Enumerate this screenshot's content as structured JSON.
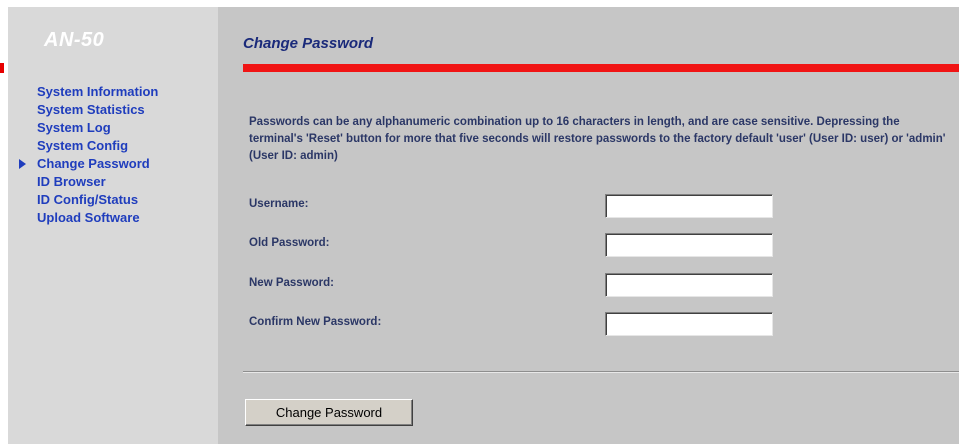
{
  "sidebar": {
    "logo": "AN-50",
    "items": [
      {
        "label": "System Information",
        "active": false
      },
      {
        "label": "System Statistics",
        "active": false
      },
      {
        "label": "System Log",
        "active": false
      },
      {
        "label": "System Config",
        "active": false
      },
      {
        "label": "Change Password",
        "active": true
      },
      {
        "label": "ID Browser",
        "active": false
      },
      {
        "label": "ID Config/Status",
        "active": false
      },
      {
        "label": "Upload Software",
        "active": false
      }
    ]
  },
  "main": {
    "title": "Change Password",
    "description": "Passwords can be any alphanumeric combination up to 16 characters in length, and are case sensitive. Depressing the terminal's 'Reset' button for more that five seconds will restore passwords to the factory default 'user' (User ID: user) or 'admin' (User ID: admin)",
    "form": {
      "username_label": "Username:",
      "username_value": "",
      "old_password_label": "Old Password:",
      "old_password_value": "",
      "new_password_label": "New Password:",
      "new_password_value": "",
      "confirm_password_label": "Confirm New Password:",
      "confirm_password_value": "",
      "submit_label": "Change Password"
    }
  },
  "colors": {
    "sidebar_bg": "#d9d9d9",
    "main_bg": "#c6c6c6",
    "nav_link": "#1f3dbd",
    "title": "#1a2a7a",
    "accent_rule": "#f01414",
    "logo_text": "#ffffff"
  }
}
